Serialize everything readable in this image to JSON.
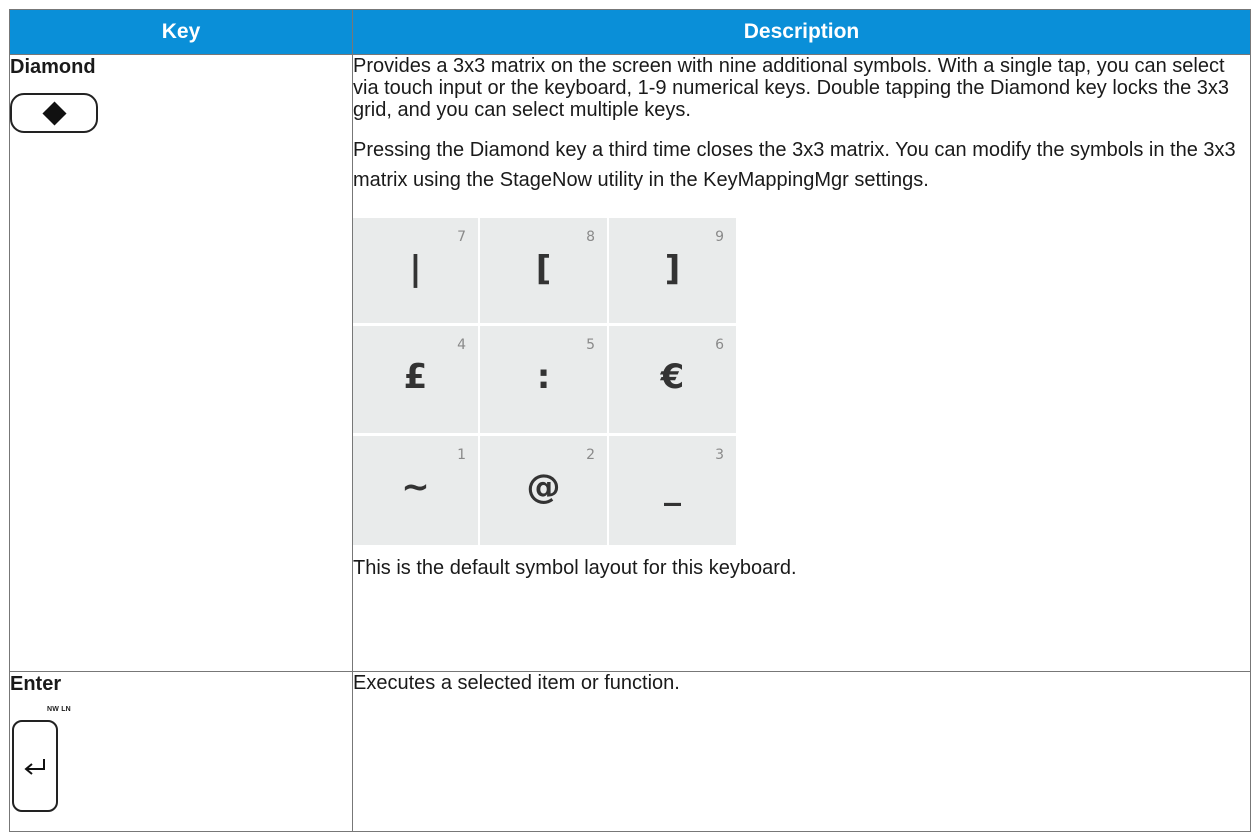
{
  "table": {
    "headers": {
      "key": "Key",
      "description": "Description"
    },
    "rows": [
      {
        "key": "Diamond",
        "icon": "diamond-key-icon",
        "description": {
          "p1": "Provides a 3x3 matrix on the screen with nine additional symbols. With a single tap, you can select via touch input or the keyboard, 1-9 numerical keys. Double tapping the Diamond key locks the 3x3 grid, and you can select multiple keys.",
          "p2": "Pressing the Diamond key a third time closes the 3x3 matrix. You can modify the symbols in the 3x3 matrix using the StageNow utility in the KeyMappingMgr settings.",
          "grid": [
            {
              "num": "7",
              "symbol": "|"
            },
            {
              "num": "8",
              "symbol": "["
            },
            {
              "num": "9",
              "symbol": "]"
            },
            {
              "num": "4",
              "symbol": "£"
            },
            {
              "num": "5",
              "symbol": ":"
            },
            {
              "num": "6",
              "symbol": "€"
            },
            {
              "num": "1",
              "symbol": "~"
            },
            {
              "num": "2",
              "symbol": "@"
            },
            {
              "num": "3",
              "symbol": "_"
            }
          ],
          "note": "This is the default symbol layout for this keyboard."
        }
      },
      {
        "key": "Enter",
        "icon": "enter-key-icon",
        "key_legend": "NW LN",
        "description": {
          "p1": "Executes a selected item or function."
        }
      }
    ]
  },
  "colors": {
    "header_bg": "#0a8fd8",
    "header_text": "#ffffff",
    "grid_bg": "#e9ebeb"
  }
}
